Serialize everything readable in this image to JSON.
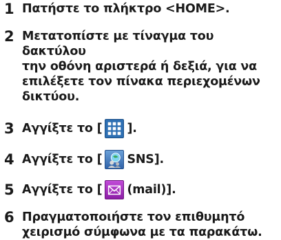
{
  "steps": [
    {
      "number": "1",
      "text": "Πατήστε το πλήκτρο <HOME>."
    },
    {
      "number": "2",
      "text": "Μετατοπίστε με τίναγμα του δακτύλου\nτην οθόνη αριστερά ή δεξιά, για να\nεπιλέξετε τον πίνακα περιεχομένων\nδικτύου."
    },
    {
      "number": "3",
      "before": "Αγγίξτε το [",
      "after": "]."
    },
    {
      "number": "4",
      "before": "Αγγίξτε το [",
      "after": "SNS]."
    },
    {
      "number": "5",
      "before": "Αγγίξτε το [",
      "after": "(mail)]."
    },
    {
      "number": "6",
      "text": "Πραγματοποιήστε τον επιθυμητό\nχειρισμό σύμφωνα με τα παρακάτω."
    }
  ],
  "icons": {
    "step3": "grid-menu-icon",
    "step4": "sns-icon",
    "step5": "mail-icon"
  },
  "colors": {
    "text": "#1a1a1a",
    "grid_icon": "#2d6fb3",
    "sns_icon": "#2f62a8",
    "mail_icon": "#8c1fa6"
  }
}
